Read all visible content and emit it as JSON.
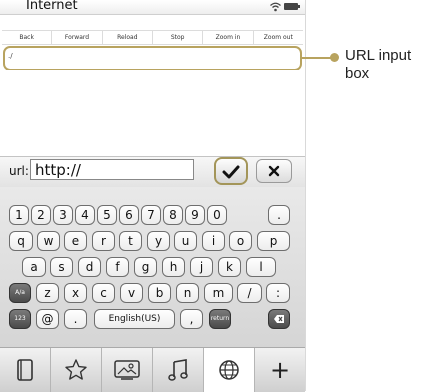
{
  "status": {
    "app_title": "Internet",
    "wifi_icon": "wifi-icon",
    "battery_icon": "battery-icon"
  },
  "toolbar": {
    "buttons": [
      "Back",
      "Forward",
      "Reload",
      "Stop",
      "Zoom in",
      "Zoom out"
    ]
  },
  "address": {
    "value": "./"
  },
  "entry": {
    "label": "url:",
    "value": "http://",
    "ok_icon": "checkmark-icon",
    "cancel_icon": "close-icon"
  },
  "keyboard": {
    "row1": [
      "1",
      "2",
      "3",
      "4",
      "5",
      "6",
      "7",
      "8",
      "9",
      "0",
      "."
    ],
    "row2": [
      "q",
      "w",
      "e",
      "r",
      "t",
      "y",
      "u",
      "i",
      "o",
      "p"
    ],
    "row3": [
      "a",
      "s",
      "d",
      "f",
      "g",
      "h",
      "j",
      "k",
      "l"
    ],
    "row4": [
      "A/a",
      "z",
      "x",
      "c",
      "v",
      "b",
      "n",
      "m",
      "/",
      ":"
    ],
    "row5": [
      "123",
      "@",
      ".",
      "English(US)",
      ",",
      "return"
    ],
    "backspace_icon": "backspace-icon"
  },
  "dock": {
    "items": [
      "notebook-icon",
      "star-icon",
      "photo-icon",
      "music-icon",
      "globe-icon",
      "+"
    ]
  },
  "callout": {
    "text": "URL input box"
  },
  "colors": {
    "highlight": "#b8a35f"
  }
}
